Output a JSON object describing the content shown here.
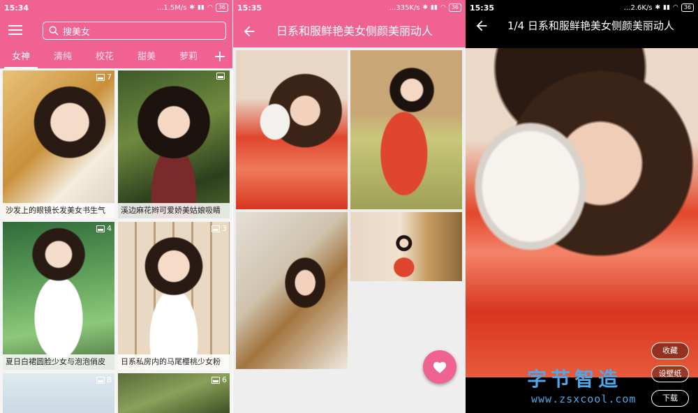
{
  "status_left": {
    "time": "15:34",
    "speed": "...1.5M/s",
    "battery": "36"
  },
  "status_mid": {
    "time": "15:35",
    "speed": "...335K/s",
    "battery": "36"
  },
  "status_right": {
    "time": "15:35",
    "speed": "...2.6K/s",
    "battery": "36"
  },
  "list_screen": {
    "search_placeholder": "搜美女",
    "tabs": [
      {
        "label": "女神",
        "active": true
      },
      {
        "label": "清纯",
        "active": false
      },
      {
        "label": "校花",
        "active": false
      },
      {
        "label": "甜美",
        "active": false
      },
      {
        "label": "萝莉",
        "active": false
      }
    ],
    "add_tab_label": "+",
    "cards": [
      {
        "caption": "沙发上的眼镜长发美女书生气",
        "count": "7"
      },
      {
        "caption": "溪边麻花辫可爱娇美姑娘吸睛",
        "count": ""
      },
      {
        "caption": "夏日白裙圆脸少女与泡泡俏皮",
        "count": "4"
      },
      {
        "caption": "日系私房内的马尾樱桃少女粉",
        "count": "3"
      },
      {
        "caption": "",
        "count": "8"
      },
      {
        "caption": "",
        "count": "6"
      }
    ]
  },
  "album_screen": {
    "title": "日系和服鲜艳美女侧颜美丽动人"
  },
  "viewer_screen": {
    "title": "1/4 日系和服鲜艳美女侧颜美丽动人",
    "actions": {
      "collect": "收藏",
      "wallpaper": "设壁纸",
      "download": "下载"
    },
    "watermark_text": "字节智造",
    "watermark_url": "www.zsxcool.com"
  },
  "colors": {
    "primary": "#f06292",
    "watermark": "#4fa7e8"
  },
  "icons": [
    "menu-icon",
    "search-icon",
    "gallery-count-icon",
    "back-arrow-icon",
    "heart-icon"
  ]
}
